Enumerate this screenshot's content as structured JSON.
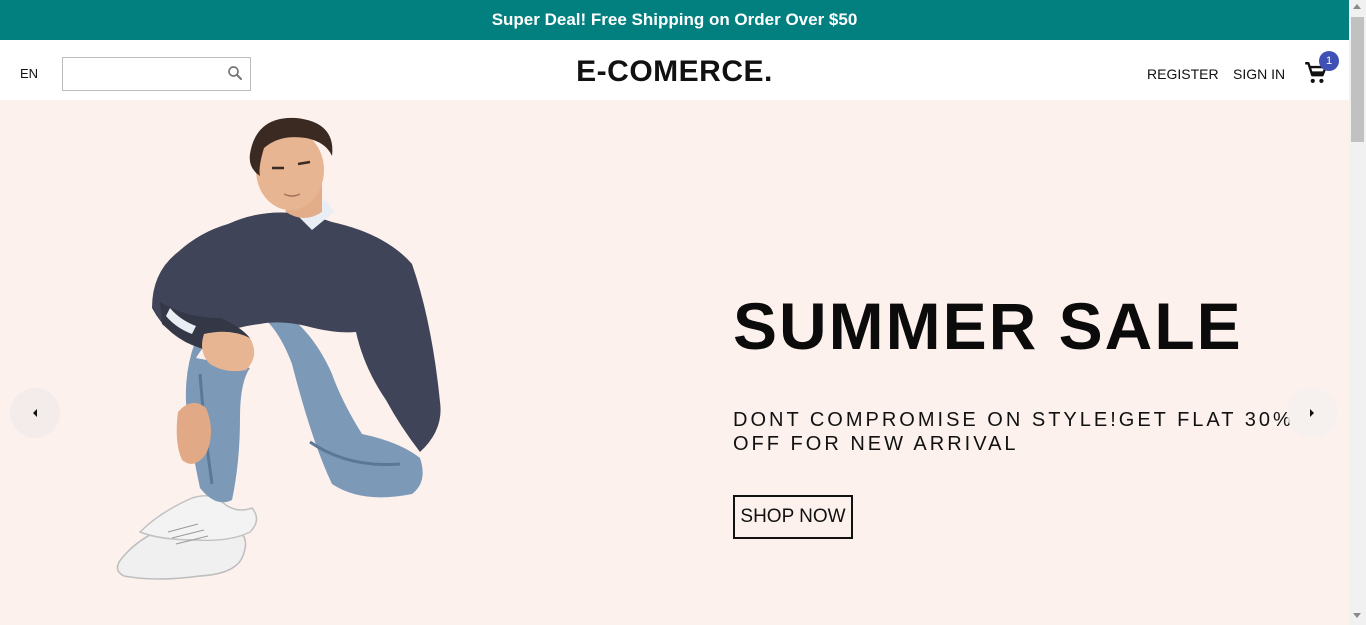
{
  "announcement": {
    "text": "Super Deal! Free Shipping on Order Over $50",
    "background": "#028080"
  },
  "navbar": {
    "language": "EN",
    "search": {
      "value": "",
      "placeholder": "",
      "icon": "search-icon"
    },
    "logo": "E-COMERCE.",
    "links": {
      "register": "REGISTER",
      "signin": "SIGN IN"
    },
    "cart": {
      "icon": "shopping-cart-icon",
      "count": "1",
      "badge_color": "#3f51b5"
    }
  },
  "hero": {
    "background": "#fcf1ed",
    "title": "SUMMER SALE",
    "description": "DONT COMPROMISE ON STYLE!GET FLAT 30% OFF FOR NEW ARRIVAL",
    "button": "SHOP NOW",
    "prev_icon": "arrow-left-icon",
    "next_icon": "arrow-right-icon"
  }
}
